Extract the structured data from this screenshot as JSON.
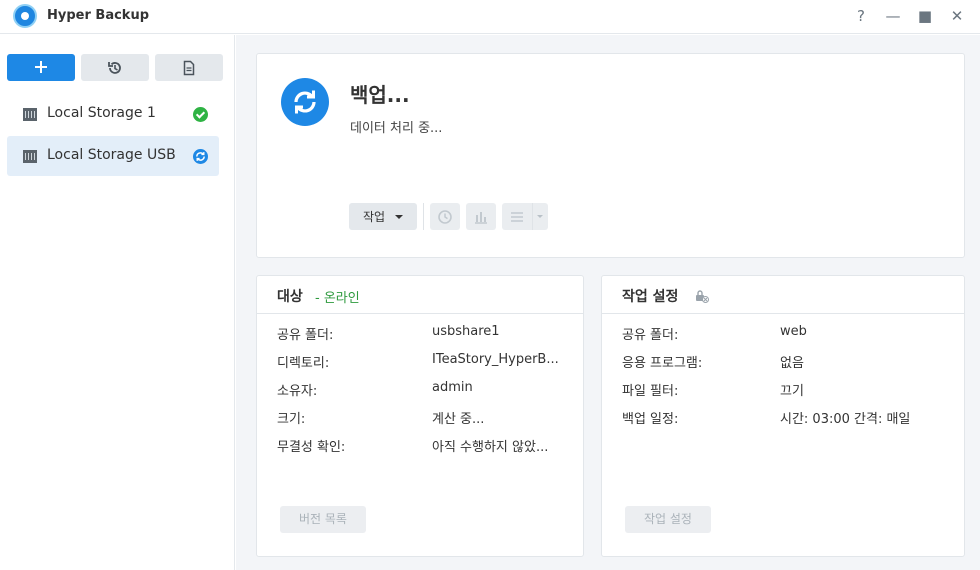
{
  "window": {
    "title": "Hyper Backup",
    "controls": {
      "help": "?",
      "minimize": "—",
      "maximize": "■",
      "close": "✕"
    }
  },
  "sidebar": {
    "tasks": [
      {
        "name": "Local Storage 1",
        "status": "success"
      },
      {
        "name": "Local Storage USB",
        "status": "syncing",
        "selected": true
      }
    ]
  },
  "status_panel": {
    "title": "백업...",
    "subtitle": "데이터 처리 중...",
    "task_button": "작업"
  },
  "target_card": {
    "title": "대상",
    "status": "- 온라인",
    "rows": [
      {
        "key": "공유 폴더:",
        "value": "usbshare1"
      },
      {
        "key": "디렉토리:",
        "value": "ITeaStory_HyperB..."
      },
      {
        "key": "소유자:",
        "value": "admin"
      },
      {
        "key": "크기:",
        "value": "계산 중..."
      },
      {
        "key": "무결성 확인:",
        "value": "아직 수행하지 않았..."
      }
    ],
    "footer_button": "버전 목록"
  },
  "settings_card": {
    "title": "작업 설정",
    "rows": [
      {
        "key": "공유 폴더:",
        "value": "web"
      },
      {
        "key": "응용 프로그램:",
        "value": "없음"
      },
      {
        "key": "파일 필터:",
        "value": "끄기"
      },
      {
        "key": "백업 일정:",
        "value": "시간: 03:00 간격: 매일"
      }
    ],
    "footer_button": "작업 설정"
  },
  "colors": {
    "accent": "#1e88e5",
    "success": "#2fb344",
    "online": "#2e9a3e"
  }
}
